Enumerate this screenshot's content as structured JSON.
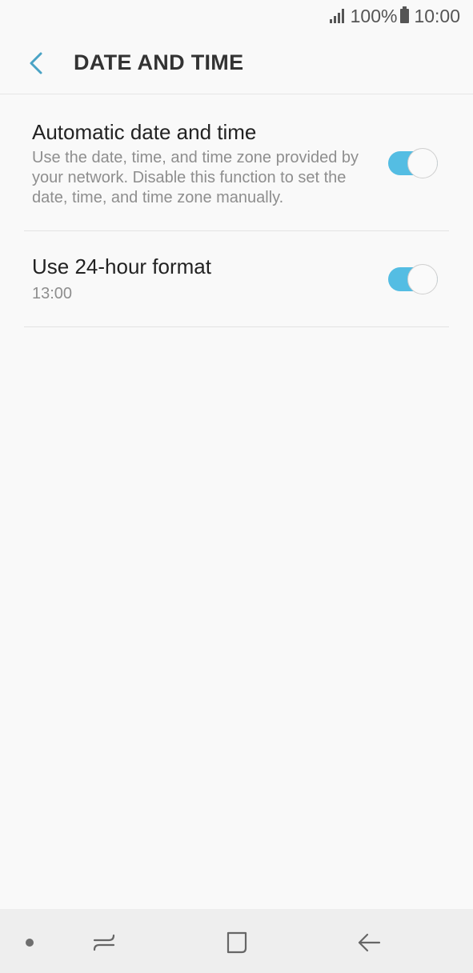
{
  "status_bar": {
    "battery": "100%",
    "time": "10:00",
    "signal_icon": "signal-icon",
    "battery_icon": "battery-icon"
  },
  "header": {
    "back_icon": "back-arrow-icon",
    "title": "DATE AND TIME"
  },
  "settings": [
    {
      "title": "Automatic date and time",
      "description": "Use the date, time, and time zone provided by your network. Disable this function to set the date, time, and time zone manually.",
      "toggle": "on"
    },
    {
      "title": "Use 24-hour format",
      "value": "13:00",
      "toggle": "on"
    }
  ],
  "nav_bar": {
    "recents_icon": "recents-icon",
    "home_icon": "home-icon",
    "back_icon": "back-icon"
  },
  "colors": {
    "accent": "#54bde3",
    "back_arrow": "#4aa3c5",
    "background": "#f9f9f9",
    "nav_bar": "#eeeeee"
  }
}
